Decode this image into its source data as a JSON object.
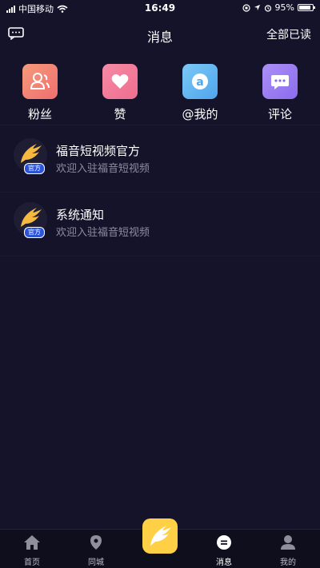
{
  "status_bar": {
    "carrier": "中国移动",
    "time": "16:49",
    "battery": "95%"
  },
  "header": {
    "title": "消息",
    "mark_all_read": "全部已读"
  },
  "categories": [
    {
      "label": "粉丝",
      "icon": "fans-icon",
      "color": "#f27d7d"
    },
    {
      "label": "赞",
      "icon": "heart-icon",
      "color": "#f2789a"
    },
    {
      "label": "@我的",
      "icon": "at-icon",
      "color": "#5fb4f0"
    },
    {
      "label": "评论",
      "icon": "comment-icon",
      "color": "#9b7cf2"
    }
  ],
  "messages": [
    {
      "title": "福音短视频官方",
      "subtitle": "欢迎入驻福音短视频",
      "badge": "官方"
    },
    {
      "title": "系统通知",
      "subtitle": "欢迎入驻福音短视频",
      "badge": "官方"
    }
  ],
  "tabbar": {
    "items": [
      {
        "label": "首页",
        "icon": "home-icon"
      },
      {
        "label": "同城",
        "icon": "location-icon"
      },
      {
        "label": "",
        "icon": "wing-icon"
      },
      {
        "label": "消息",
        "icon": "message-icon"
      },
      {
        "label": "我的",
        "icon": "profile-icon"
      }
    ]
  },
  "colors": {
    "background": "#15132a",
    "accent": "#ffd045",
    "badge": "#2e55d8"
  }
}
